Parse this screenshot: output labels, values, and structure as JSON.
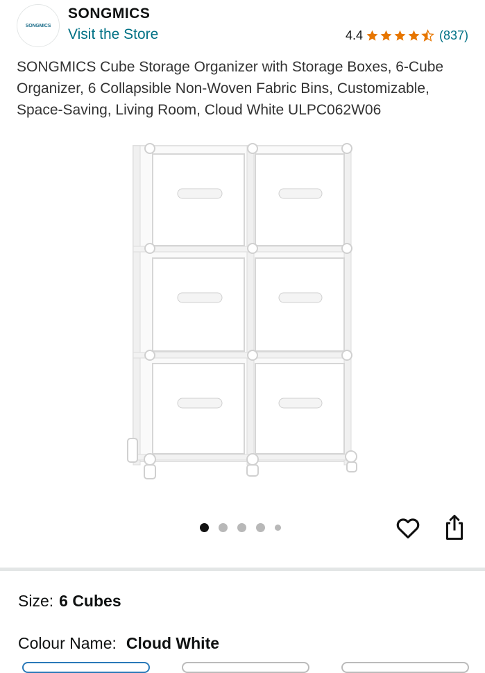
{
  "header": {
    "logo_text": "SONGMICS",
    "brand": "SONGMICS",
    "store_link": "Visit the Store",
    "rating": "4.4",
    "rating_value": 4.4,
    "rating_count": "(837)",
    "star_color": "#e77600"
  },
  "product": {
    "title": "SONGMICS Cube Storage Organizer with Storage Boxes, 6-Cube Organizer, 6 Collapsible Non-Woven Fabric Bins, Customizable, Space-Saving, Living Room, Cloud White ULPC062W06"
  },
  "carousel": {
    "total": 5,
    "active_index": 0
  },
  "actions": {
    "heart_icon": "heart-icon",
    "share_icon": "share-icon"
  },
  "options": {
    "size_label": "Size:",
    "size_value": "6 Cubes",
    "colour_label": "Colour Name:",
    "colour_value": "Cloud White"
  },
  "colors": {
    "link": "#007185",
    "selected_border": "#2a79b8"
  }
}
